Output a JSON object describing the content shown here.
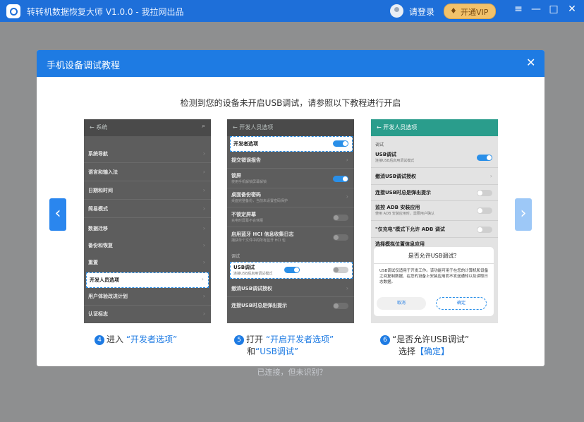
{
  "app": {
    "title": "转转机数据恢复大师 V1.0.0 - 我拉网出品",
    "login": "请登录",
    "vip": "开通VIP",
    "window_buttons": [
      "menu-icon",
      "minimize-icon",
      "maximize-icon",
      "close-icon"
    ]
  },
  "background_status": "已连接，但未识别？",
  "modal": {
    "title": "手机设备调试教程",
    "close": "✕",
    "subtitle": "检测到您的设备未开启USB调试，请参照以下教程进行开启",
    "prev": "‹",
    "next": "›"
  },
  "phone1": {
    "header": "系统",
    "items": [
      "系统导航",
      "语言和输入法",
      "日期和时间",
      "简易模式",
      "数据迁移",
      "备份和恢复",
      "重置",
      "开发人员选项",
      "用户体验改进计划",
      "认证标志"
    ]
  },
  "phone2": {
    "header": "开发人员选项",
    "top": "开发者选项",
    "items": [
      {
        "t": "提交错误报告",
        "s": ""
      },
      {
        "t": "锁屏",
        "s": "使用手机解锁屏幕解锁"
      },
      {
        "t": "桌面备份密码",
        "s": "桌面完整备份，当前未设置密码保护"
      },
      {
        "t": "不锁定屏幕",
        "s": "充电时屏幕不会休眠"
      },
      {
        "t": "启用蓝牙 HCI 信息收集日志",
        "s": "捕获单个文件中的所有蓝牙 HCI 包"
      }
    ],
    "section": "调试",
    "usb_title": "USB调试",
    "usb_sub": "连接USB后启用调试模式",
    "cancel_auth": "撤消USB调试授权",
    "prompt": "连接USB时总是弹出提示"
  },
  "phone3": {
    "header": "开发人员选项",
    "section": "调试",
    "items": [
      {
        "t": "USB调试",
        "s": "连接USB后启用调试模式"
      },
      {
        "t": "撤消USB调试授权",
        "s": ""
      },
      {
        "t": "连接USB时总是弹出提示",
        "s": ""
      },
      {
        "t": "监控 ADB 安装应用",
        "s": "使用 ADB 安装应用时，需要用户确认"
      },
      {
        "t": "\"仅充电\"模式下允许 ADB 调试",
        "s": ""
      },
      {
        "t": "选择模拟位置信息应用",
        "s": ""
      }
    ],
    "dialog": {
      "title": "是否允许USB调试？",
      "body": "USB调试仅适用于开发工作。该功能可用于在您的计算机和设备之间复制数据、在您的设备上安装应用而不发送通知以及读取日志数据。",
      "cancel": "取消",
      "ok": "确定"
    }
  },
  "captions": {
    "s4": {
      "num": "4",
      "pre": "进入",
      "hl": "“开发者选项”"
    },
    "s5": {
      "num": "5",
      "pre": "打开",
      "hl1": "“开启开发者选项”",
      "and": "和",
      "hl2": "“USB调试”"
    },
    "s6": {
      "num": "6",
      "pre": "“是否允许USB调试”",
      "sel": "选择",
      "hl": "【确定】"
    }
  },
  "colors": {
    "primary": "#1e7be3",
    "titlebar": "#1e6fd9",
    "vip": "#f2c26b",
    "teal": "#2a9d8c"
  }
}
